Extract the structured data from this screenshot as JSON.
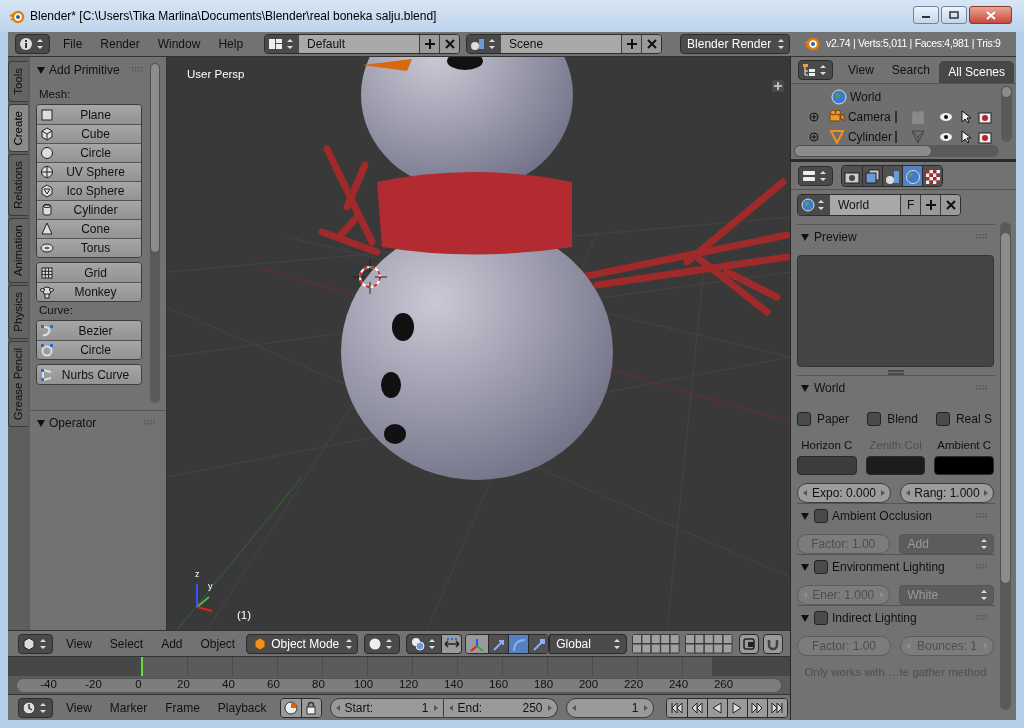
{
  "window": {
    "title": "Blender* [C:\\Users\\Tika Marlina\\Documents\\Blender\\real boneka salju.blend]"
  },
  "info_header": {
    "menus": [
      "File",
      "Render",
      "Window",
      "Help"
    ],
    "screen_layout": "Default",
    "scene": "Scene",
    "render_engine": "Blender Render",
    "stats": "v2.74 | Verts:5,011 | Faces:4,981 | Tris:9"
  },
  "tool_shelf": {
    "tabs": [
      {
        "label": "Tools",
        "selected": false
      },
      {
        "label": "Create",
        "selected": true
      },
      {
        "label": "Relations",
        "selected": false
      },
      {
        "label": "Animation",
        "selected": false
      },
      {
        "label": "Physics",
        "selected": false
      },
      {
        "label": "Grease Pencil",
        "selected": false
      }
    ],
    "panel_title": "Add Primitive",
    "sections": [
      {
        "label": "Mesh:",
        "groups": [
          [
            "Plane",
            "Cube",
            "Circle",
            "UV Sphere",
            "Ico Sphere",
            "Cylinder",
            "Cone",
            "Torus"
          ],
          [
            "Grid",
            "Monkey"
          ]
        ]
      },
      {
        "label": "Curve:",
        "groups": [
          [
            "Bezier",
            "Circle"
          ],
          [
            "Nurbs Curve"
          ]
        ]
      }
    ],
    "operator_title": "Operator"
  },
  "viewport": {
    "view_name": "User Persp",
    "frame_label": "(1)",
    "axis_labels": [
      "z",
      "y"
    ]
  },
  "viewport_header": {
    "menus": [
      "View",
      "Select",
      "Add",
      "Object"
    ],
    "mode": "Object Mode",
    "manipulators": [
      {
        "kind": "translate",
        "selected": false
      },
      {
        "kind": "rotate",
        "selected": true
      },
      {
        "kind": "scale",
        "selected": false
      }
    ],
    "orientation": "Global"
  },
  "timeline": {
    "ticks": [
      "-40",
      "-20",
      "0",
      "20",
      "40",
      "60",
      "80",
      "100",
      "120",
      "140",
      "160",
      "180",
      "200",
      "220",
      "240",
      "260"
    ]
  },
  "timeline_header": {
    "menus": [
      "View",
      "Marker",
      "Frame",
      "Playback"
    ],
    "start_label": "Start:",
    "start": "1",
    "end_label": "End:",
    "end": "250",
    "current_frame": "1"
  },
  "outliner": {
    "menus": [
      "View",
      "Search"
    ],
    "display_mode": "All Scenes",
    "items": [
      {
        "name": "World",
        "kind": "world"
      },
      {
        "name": "Camera",
        "kind": "camera"
      },
      {
        "name": "Cylinder",
        "kind": "mesh"
      }
    ]
  },
  "properties": {
    "tabs": [
      {
        "kind": "render",
        "selected": false
      },
      {
        "kind": "render_layers",
        "selected": false
      },
      {
        "kind": "scene",
        "selected": false
      },
      {
        "kind": "world",
        "selected": true
      },
      {
        "kind": "texture",
        "selected": false
      }
    ],
    "world_name": "World",
    "fake_user": "F",
    "panels": [
      {
        "kind": "preview",
        "title": "Preview"
      },
      {
        "kind": "world",
        "title": "World",
        "checkboxes": [
          {
            "label": "Paper",
            "checked": false
          },
          {
            "label": "Blend",
            "checked": false
          },
          {
            "label": "Real S",
            "checked": false
          }
        ],
        "colors": [
          {
            "label": "Horizon C",
            "color": "#3d3d3d",
            "disabled": false
          },
          {
            "label": "Zenith Col",
            "color": "#1c1c1c",
            "disabled": true
          },
          {
            "label": "Ambient C",
            "color": "#000000",
            "disabled": false
          }
        ],
        "controls": [
          {
            "kind": "number",
            "text": "Expo: 0.000"
          },
          {
            "kind": "number",
            "text": "Rang: 1.000"
          }
        ]
      },
      {
        "kind": "toggle",
        "title": "Ambient Occlusion",
        "enabled": false,
        "controls": [
          {
            "kind": "slider",
            "text": "Factor: 1.00"
          },
          {
            "kind": "dropdown",
            "text": "Add"
          }
        ]
      },
      {
        "kind": "toggle",
        "title": "Environment Lighting",
        "enabled": false,
        "controls": [
          {
            "kind": "number",
            "text": "Ener: 1.000"
          },
          {
            "kind": "dropdown",
            "text": "White"
          }
        ]
      },
      {
        "kind": "toggle",
        "title": "Indirect Lighting",
        "enabled": false,
        "controls": [
          {
            "kind": "slider",
            "text": "Factor: 1.00"
          },
          {
            "kind": "number",
            "text": "Bounces: 1"
          }
        ],
        "note": "Only works with …te gather method"
      }
    ]
  }
}
